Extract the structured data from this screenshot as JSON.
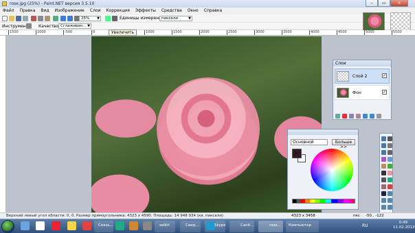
{
  "window": {
    "title": "rose.jpg (25%) - Paint.NET версия 3.5.10",
    "minimize": "–",
    "maximize": "▭",
    "close": "✕"
  },
  "menu": [
    "Файл",
    "Правка",
    "Вид",
    "Изображение",
    "Слои",
    "Коррекция",
    "Эффекты",
    "Средства",
    "Окно",
    "Справка"
  ],
  "toolbar": {
    "zoom_value": "25%",
    "units_label": "Единицы измерения:",
    "units_value": "пиксели"
  },
  "toolbar2": {
    "tool_label": "Инструмент:",
    "quality_label": "Качество:",
    "quality_value": "Сглаживан..."
  },
  "rulers": {
    "top_ticks": [
      "1500",
      "1000",
      "-500",
      "0",
      "500",
      "1000",
      "1500",
      "2000",
      "2500",
      "3000",
      "3500",
      "4000",
      "4500",
      "5000",
      "5500"
    ]
  },
  "canvas": {
    "tooltip": "Увеличить"
  },
  "layers": {
    "title": "Слои",
    "items": [
      {
        "name": "Слой 2",
        "visible": true,
        "selected": true
      },
      {
        "name": "Фон",
        "visible": true,
        "selected": false
      }
    ]
  },
  "colors": {
    "mode": "Основной",
    "more_button": "Больше >>",
    "primary": "#2a1a22",
    "secondary": "#ffffff"
  },
  "status": {
    "text": "Верхний левый угол области: 0, 0. Размер прямоугольника: 4323 x 4590. Площадь: 14 948 934 (кв. пиксели)",
    "image_size": "4323 x 3458",
    "unit": "пкс",
    "coords": "-50 , -122"
  },
  "taskbar": {
    "apps": [
      {
        "label": "Связь..."
      },
      {
        "label": "selkit"
      },
      {
        "label": "Свид..."
      },
      {
        "label": "Skype"
      },
      {
        "label": "Canti..."
      },
      {
        "label": "rose..."
      },
      {
        "label": "Компьютер"
      }
    ],
    "language": "RU",
    "time": "0:49",
    "date": "11.02.2013"
  }
}
